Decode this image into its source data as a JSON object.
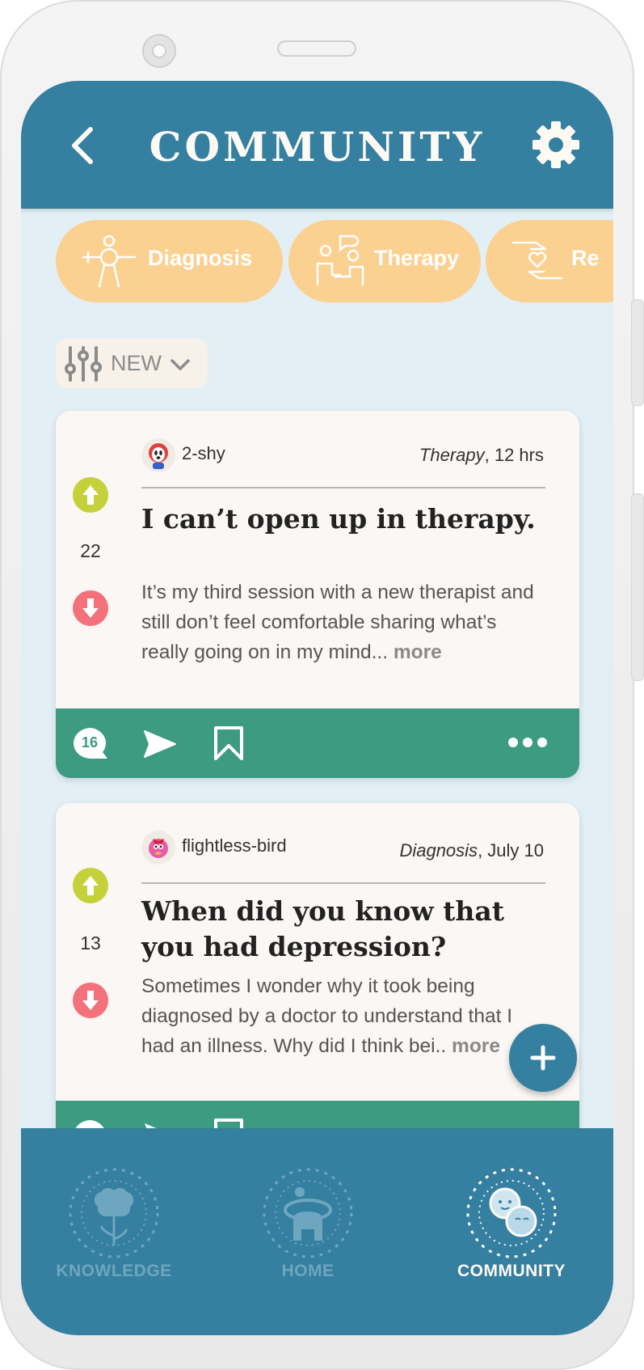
{
  "header": {
    "title": "COMMUNITY",
    "back_icon": "chevron-left-icon",
    "settings_icon": "gear-icon"
  },
  "categories": [
    {
      "label": "Diagnosis",
      "icon": "person-diagnosis-icon"
    },
    {
      "label": "Therapy",
      "icon": "therapy-session-icon"
    },
    {
      "label": "Re",
      "icon": "hands-heart-icon"
    }
  ],
  "sort": {
    "label": "NEW",
    "icon": "sliders-icon"
  },
  "posts": [
    {
      "username": "2-shy",
      "category": "Therapy",
      "time": ", 12 hrs",
      "votes": "22",
      "title": "I can’t open up in therapy.",
      "body": "It’s my third session with a new therapist and still don’t feel comfortable sharing what’s really going on in my mind...",
      "more": "more",
      "comments": "16"
    },
    {
      "username": "flightless-bird",
      "category": "Diagnosis",
      "time": ", July 10",
      "votes": "13",
      "title": "When did you know that you had depression?",
      "body": "Sometimes I wonder why it took being diagnosed by a doctor to understand that I had an illness. Why did I think bei..",
      "more": "more",
      "comments": ""
    }
  ],
  "nav": [
    {
      "label": "KNOWLEDGE",
      "active": false
    },
    {
      "label": "HOME",
      "active": false
    },
    {
      "label": "COMMUNITY",
      "active": true
    }
  ],
  "colors": {
    "header": "#357fa0",
    "background": "#e2eff5",
    "chip": "#fbd191",
    "action_bar": "#3d9b81",
    "upvote": "#c5d13a",
    "downvote": "#f2717a",
    "nav_inactive": "#6ea6bf",
    "nav_active": "#fdfaf4"
  }
}
